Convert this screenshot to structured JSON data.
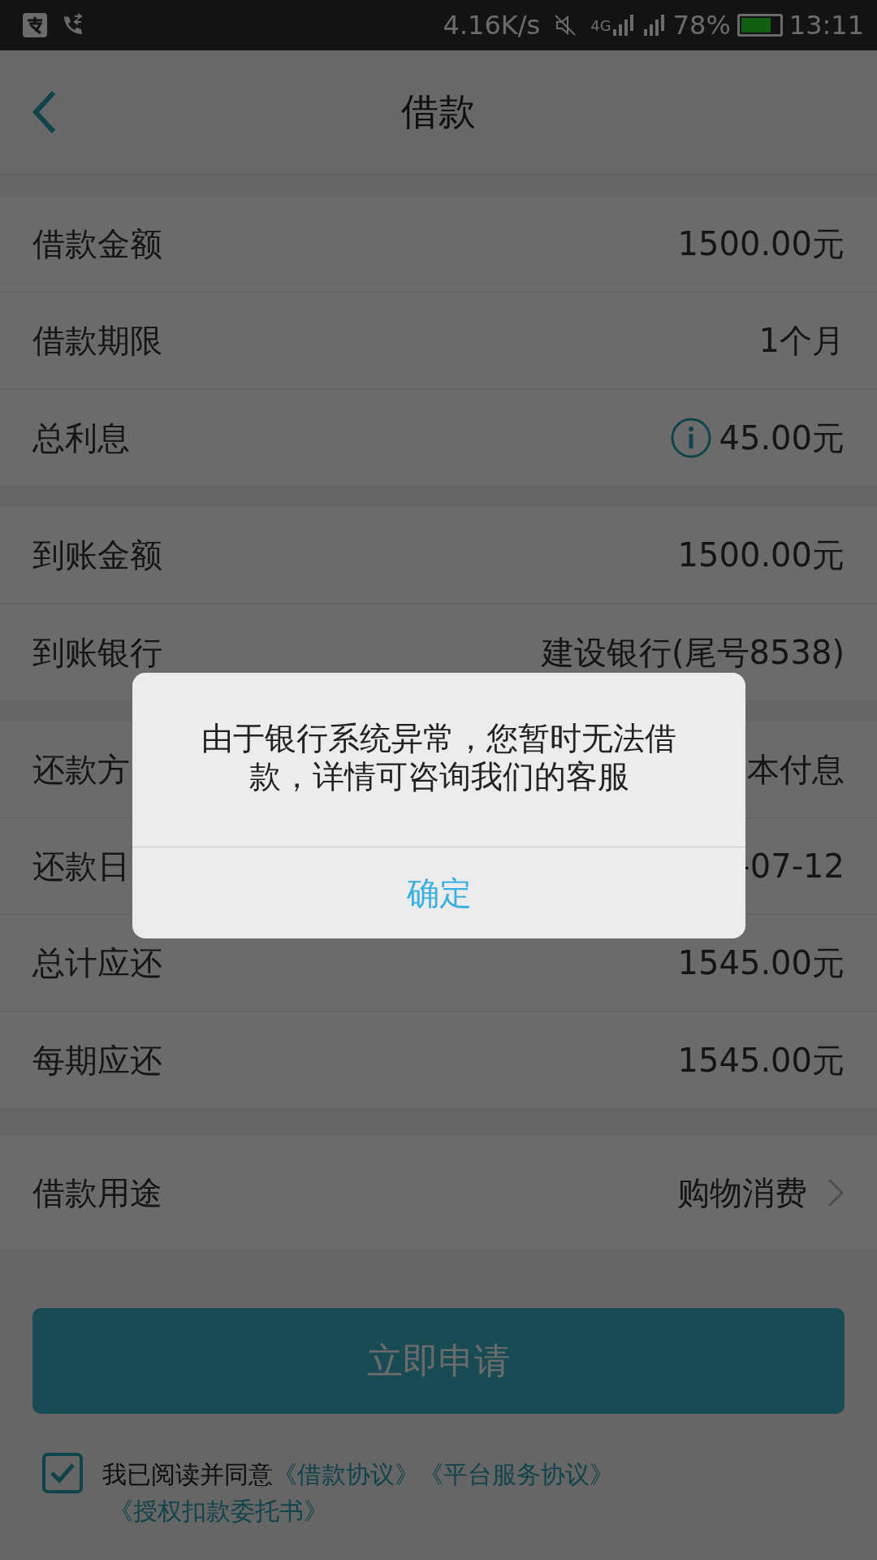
{
  "status_bar": {
    "speed": "4.16K/s",
    "network": "4G",
    "battery": "78%",
    "time": "13:11"
  },
  "header": {
    "title": "借款"
  },
  "groups": [
    {
      "rows": [
        {
          "label": "借款金额",
          "value": "1500.00元",
          "info": false
        },
        {
          "label": "借款期限",
          "value": "1个月",
          "info": false
        },
        {
          "label": "总利息",
          "value": "45.00元",
          "info": true
        }
      ]
    },
    {
      "rows": [
        {
          "label": "到账金额",
          "value": "1500.00元",
          "info": false
        },
        {
          "label": "到账银行",
          "value": "建设银行(尾号8538)",
          "info": false
        }
      ]
    },
    {
      "rows": [
        {
          "label": "还款方",
          "value": "本付息",
          "info": false
        },
        {
          "label": "还款日",
          "value": "-07-12",
          "info": false
        },
        {
          "label": "总计应还",
          "value": "1545.00元",
          "info": false
        },
        {
          "label": "每期应还",
          "value": "1545.00元",
          "info": false
        }
      ]
    }
  ],
  "purpose": {
    "label": "借款用途",
    "value": "购物消费"
  },
  "apply_button": "立即申请",
  "agreement": {
    "checked": true,
    "text": "我已阅读并同意",
    "links": [
      "《借款协议》",
      "《平台服务协议》",
      "《授权扣款委托书》"
    ]
  },
  "dialog": {
    "message": "由于银行系统异常，您暂时无法借款，详情可咨询我们的客服",
    "button": "确定"
  }
}
